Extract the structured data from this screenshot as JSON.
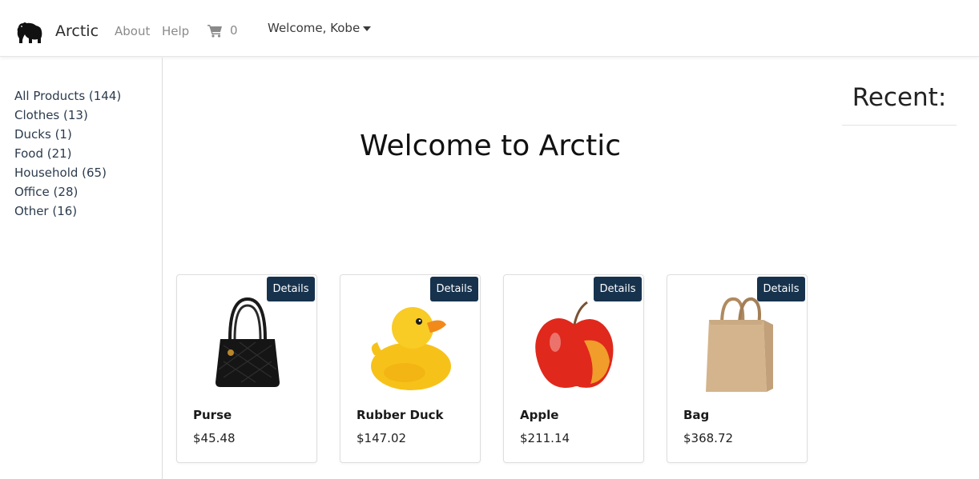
{
  "navbar": {
    "brand": "Arctic",
    "links": {
      "about": "About",
      "help": "Help"
    },
    "cart_count": "0",
    "welcome": "Welcome, Kobe"
  },
  "sidebar": {
    "categories": [
      {
        "label": "All Products (144)"
      },
      {
        "label": "Clothes (13)"
      },
      {
        "label": "Ducks (1)"
      },
      {
        "label": "Food (21)"
      },
      {
        "label": "Household (65)"
      },
      {
        "label": "Office (28)"
      },
      {
        "label": "Other (16)"
      }
    ]
  },
  "main": {
    "title": "Welcome to Arctic",
    "products": [
      {
        "name": "Purse",
        "price": "$45.48",
        "button": "Details",
        "image": "purse-image"
      },
      {
        "name": "Rubber Duck",
        "price": "$147.02",
        "button": "Details",
        "image": "rubber-duck-image"
      },
      {
        "name": "Apple",
        "price": "$211.14",
        "button": "Details",
        "image": "apple-image"
      },
      {
        "name": "Bag",
        "price": "$368.72",
        "button": "Details",
        "image": "paper-bag-image"
      }
    ]
  },
  "recent": {
    "title": "Recent:"
  },
  "colors": {
    "button": "#17324d",
    "link": "#8a8a8a",
    "category": "#2b3b4d"
  }
}
